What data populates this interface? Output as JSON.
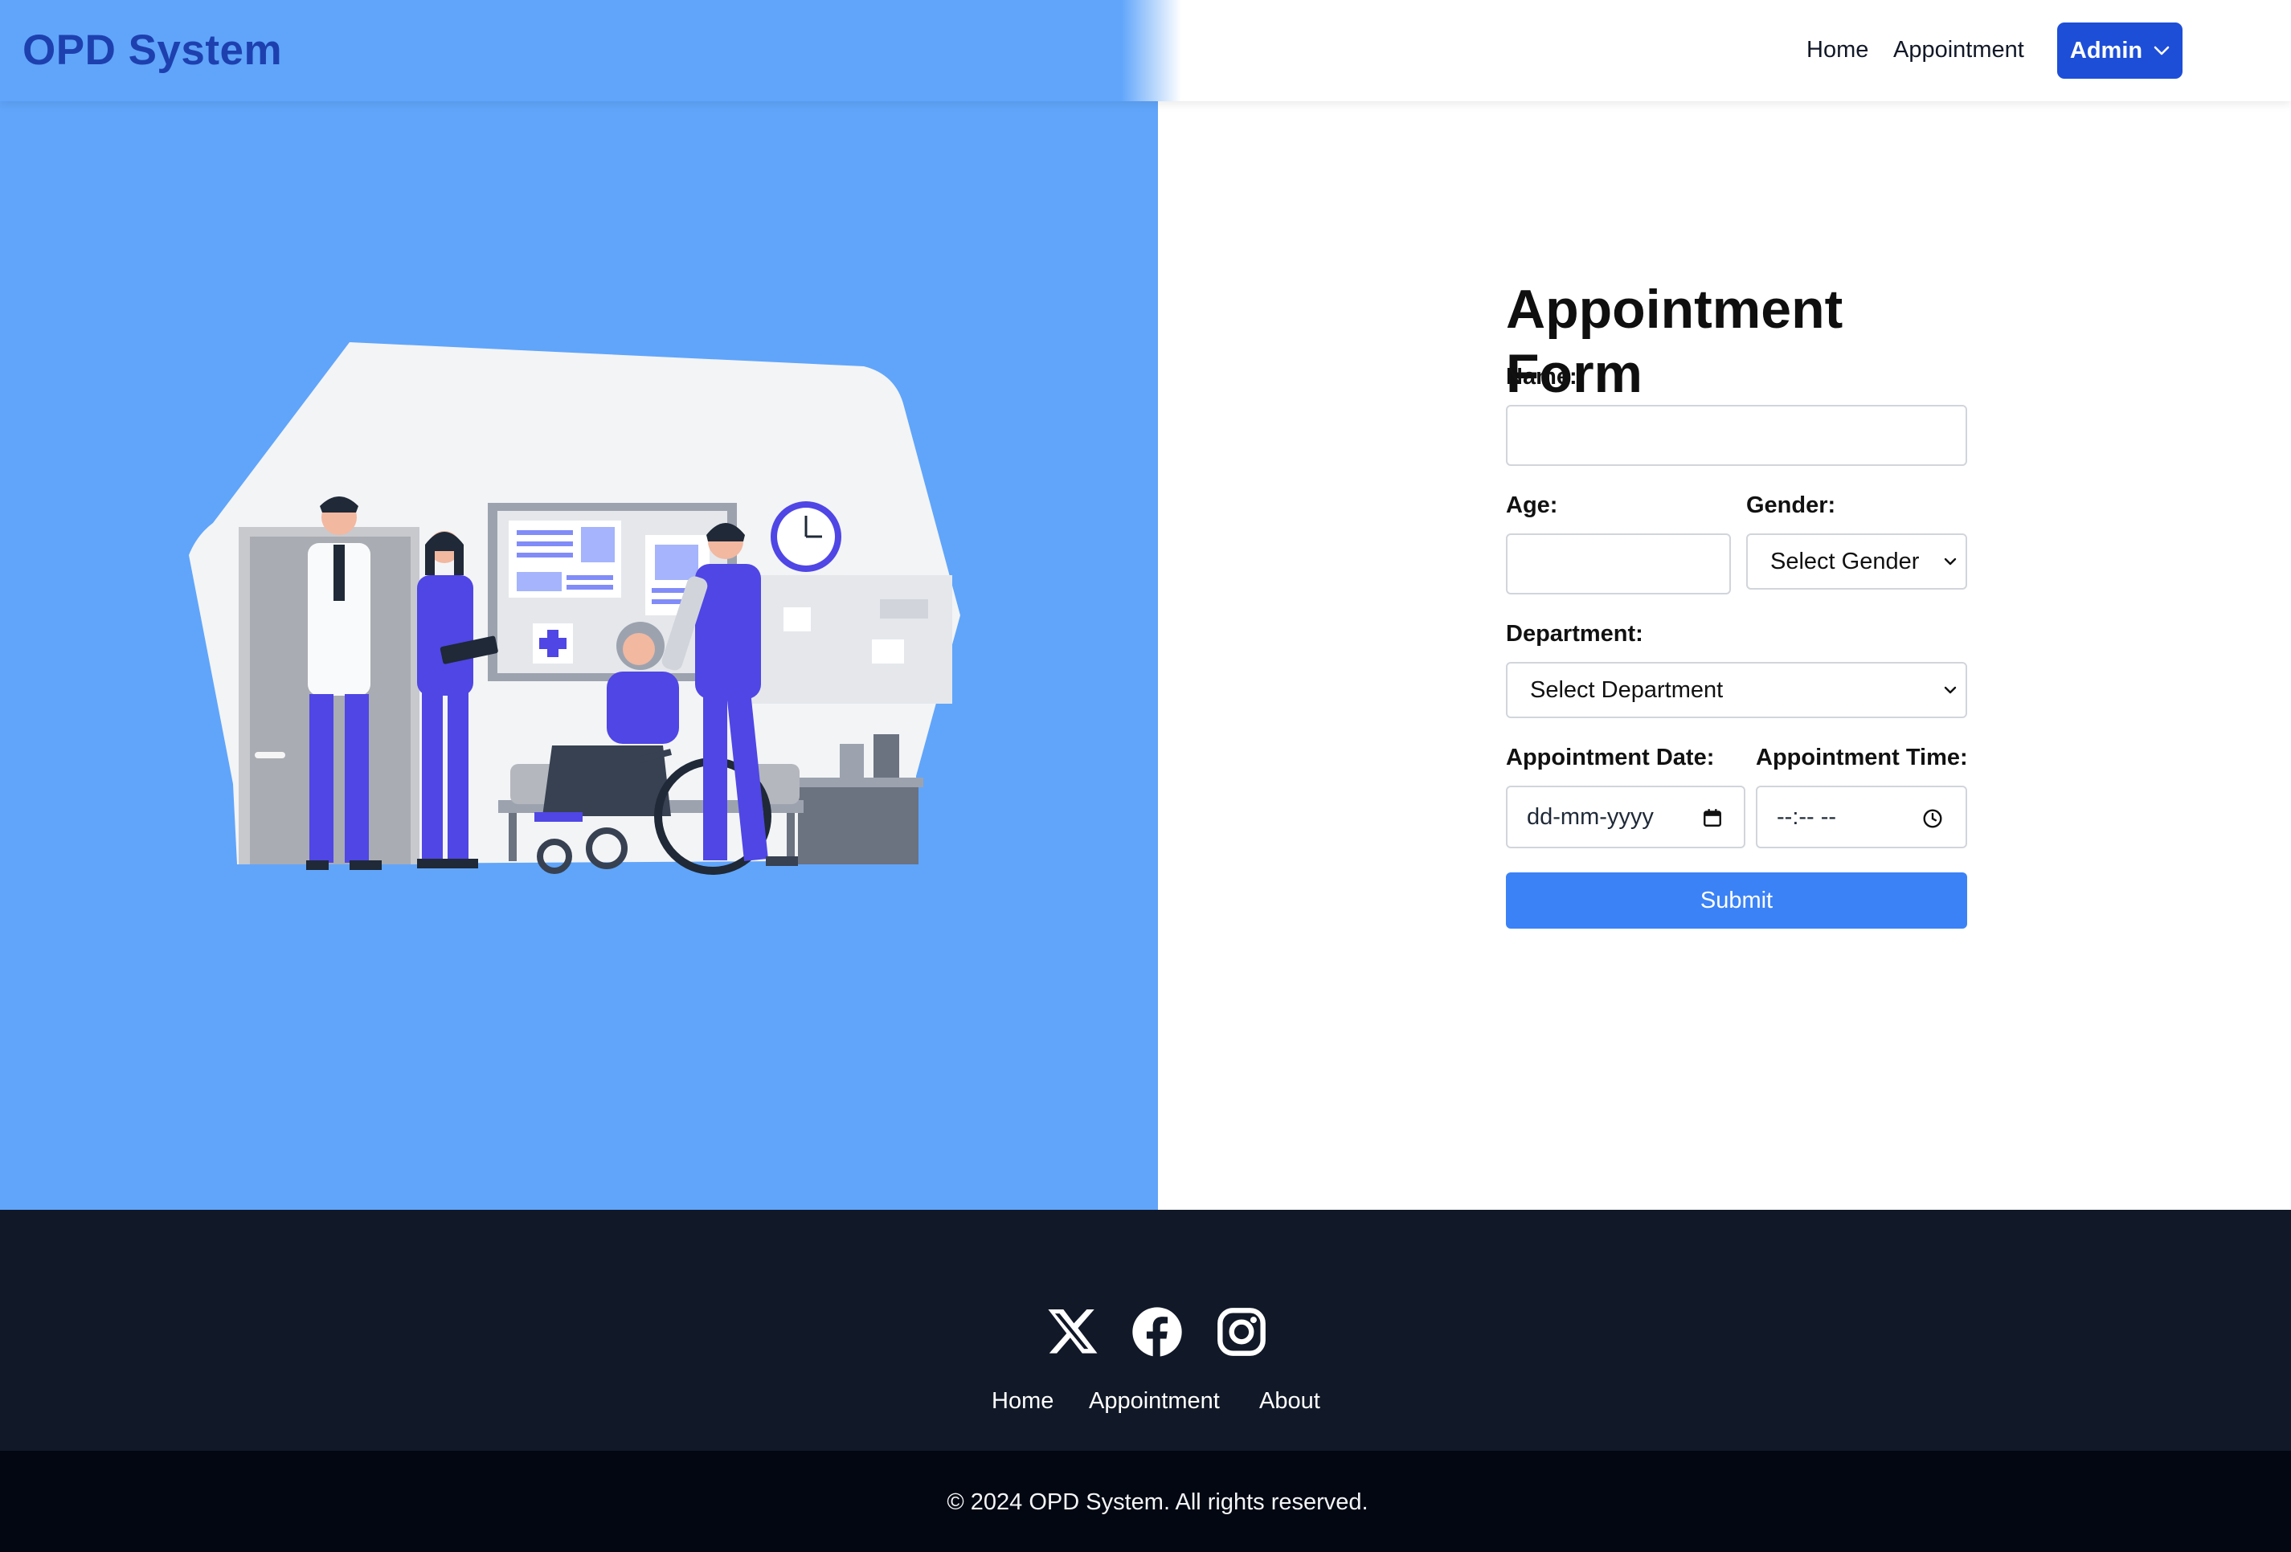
{
  "header": {
    "brand": "OPD System",
    "nav": {
      "home": "Home",
      "appointment": "Appointment"
    },
    "admin_label": "Admin"
  },
  "form": {
    "title": "Appointment Form",
    "name_label": "Name:",
    "name_value": "",
    "age_label": "Age:",
    "age_value": "",
    "gender_label": "Gender:",
    "gender_selected": "Select Gender",
    "department_label": "Department:",
    "department_selected": "Select Department",
    "date_label": "Appointment Date:",
    "date_placeholder": "dd-mm-yyyy",
    "time_label": "Appointment Time:",
    "time_placeholder": "--:-- --",
    "submit_label": "Submit"
  },
  "footer": {
    "social_icons": [
      "x-icon",
      "facebook-icon",
      "instagram-icon"
    ],
    "links": {
      "home": "Home",
      "appointment": "Appointment",
      "about": "About"
    },
    "copyright": "© 2024 OPD System. All rights reserved."
  },
  "colors": {
    "hero_bg": "#60a5fa",
    "brand": "#1e40af",
    "admin_button": "#1d4ed8",
    "submit_button": "#3b82f6",
    "footer_bg": "#111827",
    "copyright_bg": "#030712"
  }
}
